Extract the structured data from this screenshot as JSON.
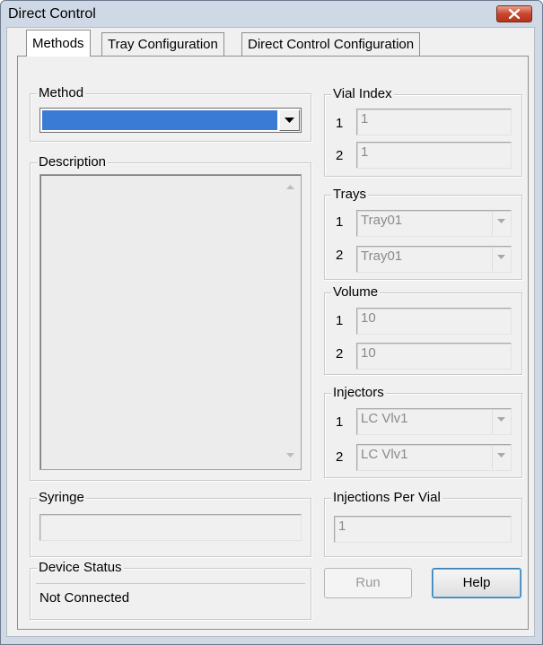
{
  "window": {
    "title": "Direct Control"
  },
  "tabs": [
    {
      "label": "Methods",
      "active": true
    },
    {
      "label": "Tray Configuration",
      "active": false
    },
    {
      "label": "Direct Control Configuration",
      "active": false
    }
  ],
  "method_group": {
    "label": "Method",
    "selected_value": ""
  },
  "description_group": {
    "label": "Description",
    "text": ""
  },
  "syringe_group": {
    "label": "Syringe",
    "value": ""
  },
  "device_status_group": {
    "label": "Device Status",
    "value": "Not Connected"
  },
  "vial_index_group": {
    "label": "Vial Index",
    "rows": [
      {
        "num": "1",
        "value": "1"
      },
      {
        "num": "2",
        "value": "1"
      }
    ]
  },
  "trays_group": {
    "label": "Trays",
    "rows": [
      {
        "num": "1",
        "value": "Tray01"
      },
      {
        "num": "2",
        "value": "Tray01"
      }
    ]
  },
  "volume_group": {
    "label": "Volume",
    "rows": [
      {
        "num": "1",
        "value": "10"
      },
      {
        "num": "2",
        "value": "10"
      }
    ]
  },
  "injectors_group": {
    "label": "Injectors",
    "rows": [
      {
        "num": "1",
        "value": "LC Vlv1"
      },
      {
        "num": "2",
        "value": "LC Vlv1"
      }
    ]
  },
  "injections_per_vial_group": {
    "label": "Injections Per Vial",
    "value": "1"
  },
  "buttons": {
    "run_label": "Run",
    "help_label": "Help"
  },
  "colors": {
    "title_bar": "#cfd9e6",
    "close_button": "#c9462e",
    "selection": "#3a7bd5",
    "dialog_bg": "#f0f0f0"
  }
}
